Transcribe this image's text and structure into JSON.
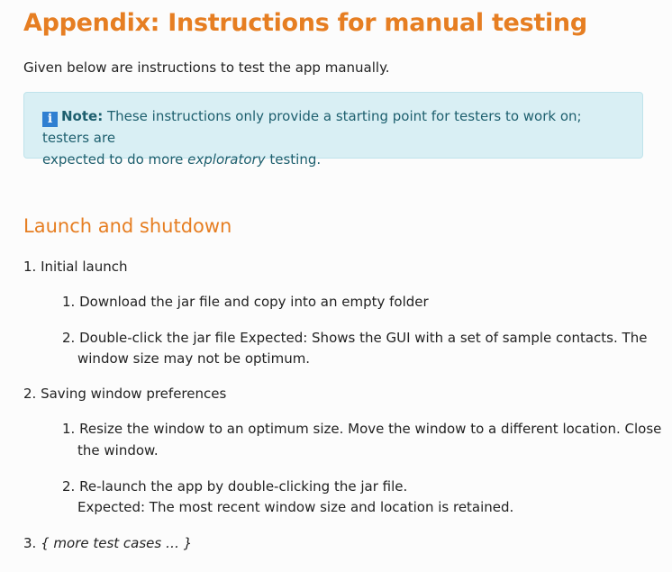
{
  "title": "Appendix: Instructions for manual testing",
  "intro": "Given below are instructions to test the app manually.",
  "note": {
    "icon": "info-icon",
    "label": "Note:",
    "text_before": " These instructions only provide a starting point for testers to work on; testers are",
    "text_line2_before": "expected to do more ",
    "text_emphasis": "exploratory",
    "text_line2_after": " testing."
  },
  "section": {
    "heading": "Launch and shutdown",
    "items": [
      {
        "number": "1.",
        "label": "Initial launch",
        "steps": [
          {
            "number": "1.",
            "line1": "Download the jar file and copy into an empty folder"
          },
          {
            "number": "2.",
            "line1": "Double-click the jar file Expected: Shows the GUI with a set of sample contacts. The",
            "line2": "window size may not be optimum."
          }
        ]
      },
      {
        "number": "2.",
        "label": "Saving window preferences",
        "steps": [
          {
            "number": "1.",
            "line1": "Resize the window to an optimum size. Move the window to a different location. Close",
            "line2": "the window."
          },
          {
            "number": "2.",
            "line1": "Re-launch the app by double-clicking the jar file.",
            "line2": "Expected: The most recent window size and location is retained."
          }
        ]
      },
      {
        "number": "3.",
        "label": "{ more test cases … }"
      }
    ]
  }
}
